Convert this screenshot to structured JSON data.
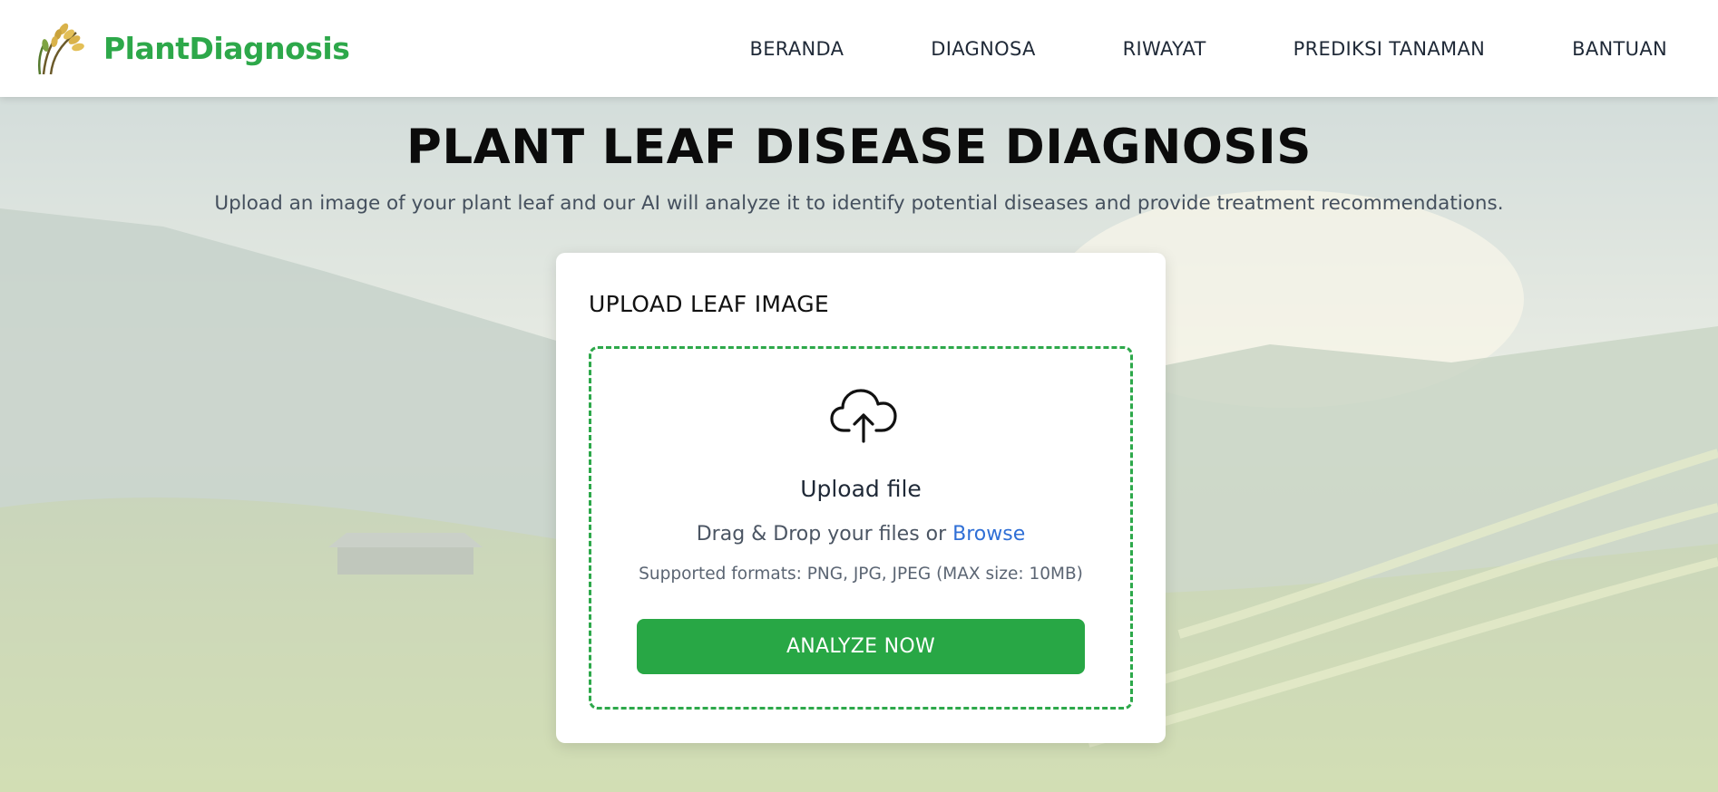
{
  "brand": {
    "name": "PlantDiagnosis",
    "logo_icon": "rice-plant-icon",
    "color": "#2da84a"
  },
  "nav": {
    "items": [
      {
        "label": "BERANDA"
      },
      {
        "label": "DIAGNOSA"
      },
      {
        "label": "RIWAYAT"
      },
      {
        "label": "PREDIKSI TANAMAN"
      },
      {
        "label": "BANTUAN"
      }
    ]
  },
  "hero": {
    "title": "PLANT LEAF DISEASE DIAGNOSIS",
    "subtitle": "Upload an image of your plant leaf and our AI will analyze it to identify potential diseases and provide treatment recommendations."
  },
  "upload_card": {
    "title": "UPLOAD LEAF IMAGE",
    "icon": "cloud-upload-icon",
    "upload_label": "Upload file",
    "drag_text": "Drag & Drop your files or",
    "browse_label": "Browse",
    "formats": "Supported formats: PNG, JPG, JPEG (MAX size: 10MB)",
    "analyze_label": "ANALYZE NOW",
    "accent_color": "#28a745",
    "link_color": "#2f6fd6"
  }
}
